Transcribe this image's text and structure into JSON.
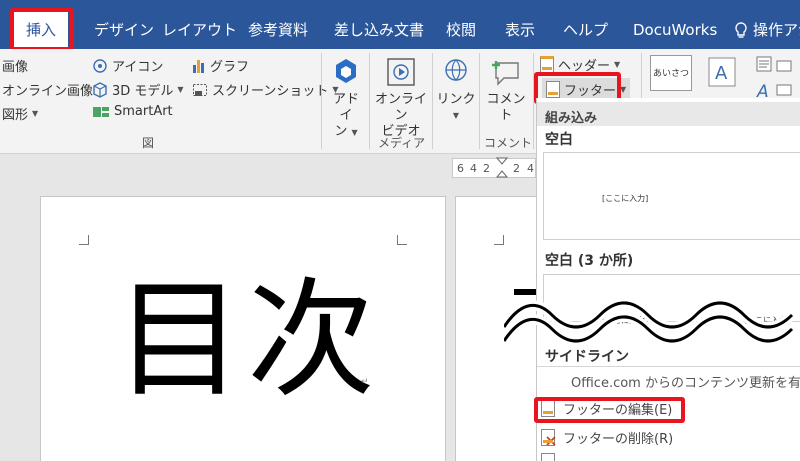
{
  "tabs": [
    {
      "label": "挿入",
      "active": true
    },
    {
      "label": "デザイン"
    },
    {
      "label": "レイアウト"
    },
    {
      "label": "参考資料"
    },
    {
      "label": "差し込み文書"
    },
    {
      "label": "校閲"
    },
    {
      "label": "表示"
    },
    {
      "label": "ヘルプ"
    },
    {
      "label": "DocuWorks"
    },
    {
      "label": "操作アシ"
    }
  ],
  "ribbon": {
    "illustrations": {
      "picture": "画像",
      "online_picture": "オンライン画像",
      "shapes": "図形",
      "icons": "アイコン",
      "model3d": "3D モデル",
      "smartart": "SmartArt",
      "chart": "グラフ",
      "screenshot": "スクリーンショット",
      "group": "図"
    },
    "addins": {
      "label1": "アドイ",
      "label2": "ン"
    },
    "media": {
      "label1": "オンライン",
      "label2": "ビデオ",
      "group": "メディア"
    },
    "link": {
      "label": "リンク"
    },
    "comment": {
      "label": "コメント",
      "group": "コメント"
    },
    "header_footer": {
      "header": "ヘッダー",
      "footer": "フッター"
    },
    "text": {
      "textbox": "あいさつ"
    }
  },
  "ruler": {
    "ticks": [
      "6",
      "4",
      "2",
      "2",
      "4"
    ]
  },
  "document": {
    "title": "目次"
  },
  "gallery": {
    "section_builtin": "組み込み",
    "blank": "空白",
    "blank_placeholder": "[ここに入力]",
    "blank3": "空白 (3 か所)",
    "section_sideline": "サイドライン",
    "more_from_office": "Office.com からのコンテンツ更新を有効",
    "edit_footer": "フッターの編集(E)",
    "remove_footer": "フッターの削除(R)"
  },
  "colors": {
    "accent": "#2b579a",
    "highlight": "#e8141e"
  }
}
